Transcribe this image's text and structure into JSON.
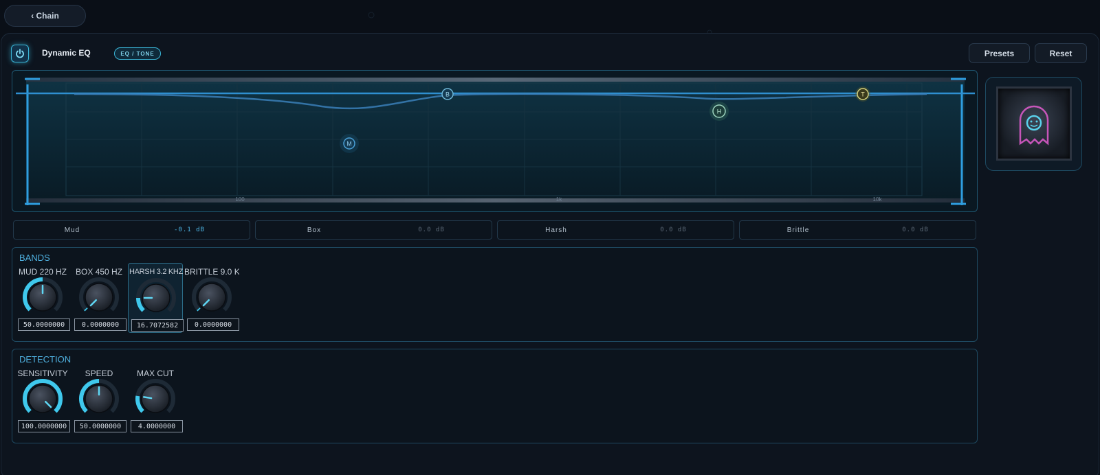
{
  "nav": {
    "back_label": "‹ Chain"
  },
  "header": {
    "title": "Dynamic EQ",
    "category": "EQ / TONE",
    "presets_label": "Presets",
    "reset_label": "Reset"
  },
  "eq": {
    "freq_labels": [
      "100",
      "1k",
      "10k"
    ],
    "nodes": [
      {
        "letter": "M",
        "color": "#4a9fd6"
      },
      {
        "letter": "B",
        "color": "#6fb8d8"
      },
      {
        "letter": "H",
        "color": "#9fd6c0"
      },
      {
        "letter": "T",
        "color": "#d6d27a"
      }
    ]
  },
  "readouts": [
    {
      "name": "Mud",
      "value": "-0.1 dB",
      "active": true
    },
    {
      "name": "Box",
      "value": "0.0 dB",
      "active": false
    },
    {
      "name": "Harsh",
      "value": "0.0 dB",
      "active": false
    },
    {
      "name": "Brittle",
      "value": "0.0 dB",
      "active": false
    }
  ],
  "bands": {
    "title": "BANDS",
    "knobs": [
      {
        "label": "MUD 220 HZ",
        "value": "50.0000000",
        "level": 0.5
      },
      {
        "label": "BOX 450 HZ",
        "value": "0.0000000",
        "level": 0.0
      },
      {
        "label": "HARSH 3.2 KHZ",
        "value": "16.7072582",
        "level": 0.167,
        "highlight": true
      },
      {
        "label": "BRITTLE 9.0 K...",
        "value": "0.0000000",
        "level": 0.0
      }
    ]
  },
  "detection": {
    "title": "DETECTION",
    "knobs": [
      {
        "label": "SENSITIVITY",
        "value": "100.0000000",
        "level": 1.0
      },
      {
        "label": "SPEED",
        "value": "50.0000000",
        "level": 0.5
      },
      {
        "label": "MAX CUT",
        "value": "4.0000000",
        "level": 0.2
      }
    ]
  },
  "colors": {
    "accent": "#3ab6d8",
    "eq_line": "#3a8fc8",
    "panel_border": "#1e4a62"
  }
}
